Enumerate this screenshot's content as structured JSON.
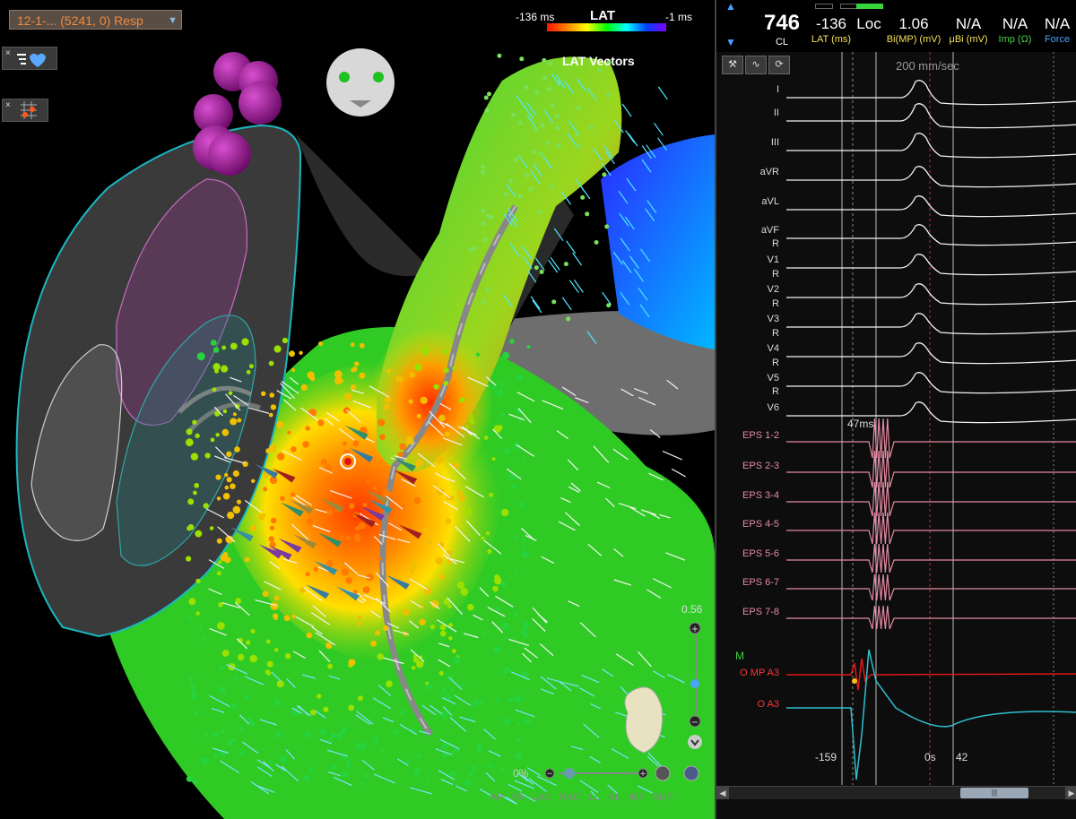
{
  "map": {
    "map_name": "12-1-... (5241, 0) Resp",
    "lat_title": "LAT",
    "lat_min": "-136 ms",
    "lat_max": "-1 ms",
    "vectors_label": "LAT Vectors",
    "zoom_value": "0.56",
    "transparency_label": "0%",
    "views": [
      "AP",
      "PA",
      "LAC",
      "RAO",
      "LL",
      "RL",
      "INF",
      "SUP"
    ],
    "colors": {
      "early": "#ff1500",
      "late": "#8000ff",
      "tissue": "#35c81a",
      "shell": "#3a3a3a"
    }
  },
  "ecg": {
    "metrics": [
      {
        "value": "746",
        "label": "CL",
        "label_color": "#ffffff"
      },
      {
        "value": "-136",
        "label": "LAT (ms)",
        "label_color": "#f7e05a"
      },
      {
        "value": "Loc",
        "label": "",
        "label_color": "#ffffff"
      },
      {
        "value": "1.06",
        "label": "Bi(MP) (mV)",
        "label_color": "#f7e05a"
      },
      {
        "value": "N/A",
        "label": "μBi (mV)",
        "label_color": "#f7e05a"
      },
      {
        "value": "N/A",
        "label": "Imp (Ω)",
        "label_color": "#4bd44b"
      },
      {
        "value": "N/A",
        "label": "Force",
        "label_color": "#4aa3ff"
      }
    ],
    "sweep_speed": "200 mm/sec",
    "surface_leads": [
      "I",
      "II",
      "III",
      "aVR",
      "aVL",
      "aVF",
      "R",
      "V1",
      "R",
      "V2",
      "R",
      "V3",
      "R",
      "V4",
      "R",
      "V5",
      "R",
      "V6"
    ],
    "eps_channels": [
      "EPS 1-2",
      "EPS 2-3",
      "EPS 3-4",
      "EPS 4-5",
      "EPS 5-6",
      "EPS 6-7",
      "EPS 7-8"
    ],
    "mapping_marker": "M",
    "mapping_channels": [
      "O MP A3",
      "O A3"
    ],
    "caliper": "47ms",
    "time_marks": {
      "left": "-159",
      "zero": "0s",
      "right": "42"
    }
  }
}
